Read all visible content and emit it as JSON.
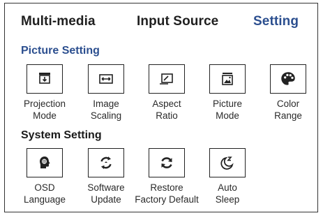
{
  "tabs": {
    "multimedia": "Multi-media",
    "input_source": "Input Source",
    "setting": "Setting"
  },
  "picture_setting": {
    "title": "Picture Setting",
    "items": [
      {
        "label": "Projection\nMode",
        "icon": "projection-mode-icon"
      },
      {
        "label": "Image\nScaling",
        "icon": "image-scaling-icon"
      },
      {
        "label": "Aspect\nRatio",
        "icon": "aspect-ratio-icon"
      },
      {
        "label": "Picture\nMode",
        "icon": "picture-mode-icon"
      },
      {
        "label": "Color\nRange",
        "icon": "palette-icon"
      }
    ]
  },
  "system_setting": {
    "title": "System Setting",
    "items": [
      {
        "label": "OSD\nLanguage",
        "icon": "language-icon"
      },
      {
        "label": "Software\nUpdate",
        "icon": "software-update-icon"
      },
      {
        "label": "Restore\nFactory Default",
        "icon": "restore-icon"
      },
      {
        "label": "Auto\nSleep",
        "icon": "sleep-icon"
      }
    ]
  },
  "colors": {
    "accent": "#2c4f8f",
    "text": "#1a1a1a",
    "border": "#222222"
  }
}
